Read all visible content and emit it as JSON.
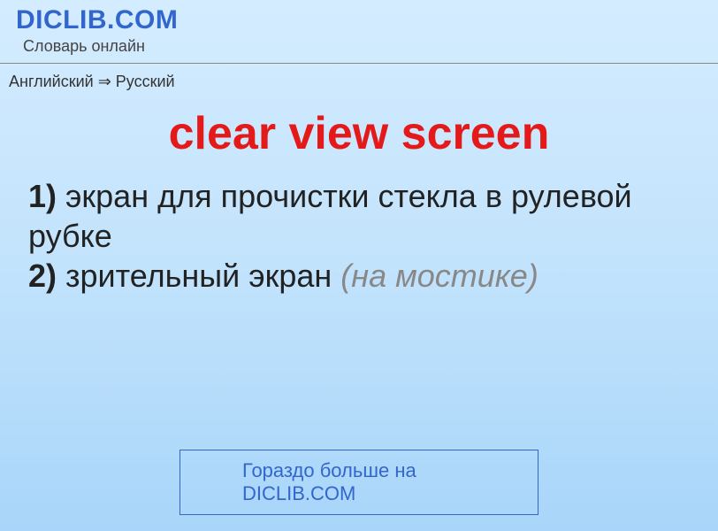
{
  "header": {
    "site_title": "DICLIB.COM",
    "tagline": "Словарь онлайн"
  },
  "breadcrumb": {
    "text": "Английский ⇒ Русский"
  },
  "entry": {
    "term": "clear view screen",
    "definitions": [
      {
        "num": "1)",
        "text": "экран для прочистки стекла в рулевой рубке",
        "note": ""
      },
      {
        "num": "2)",
        "text": "зрительный экран",
        "note": "(на мостике)"
      }
    ]
  },
  "footer": {
    "link_text": "Гораздо больше на DICLIB.COM"
  }
}
